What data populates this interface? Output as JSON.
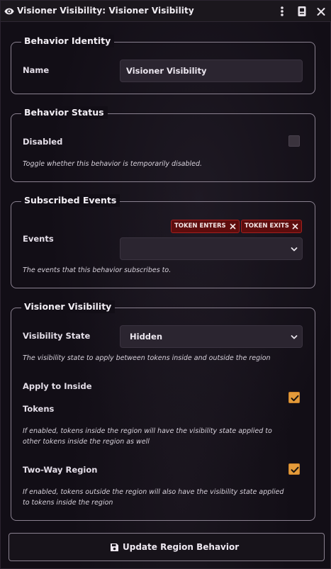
{
  "window": {
    "title": "Visioner Visibility: Visioner Visibility"
  },
  "behavior_identity": {
    "legend": "Behavior Identity",
    "name_label": "Name",
    "name_value": "Visioner Visibility"
  },
  "behavior_status": {
    "legend": "Behavior Status",
    "disabled_label": "Disabled",
    "disabled_checked": false,
    "hint": "Toggle whether this behavior is temporarily disabled."
  },
  "subscribed_events": {
    "legend": "Subscribed Events",
    "events_label": "Events",
    "tags": [
      "TOKEN ENTERS",
      "TOKEN EXITS"
    ],
    "select_value": "",
    "hint": "The events that this behavior subscribes to."
  },
  "visioner_visibility": {
    "legend": "Visioner Visibility",
    "visibility_state_label": "Visibility State",
    "visibility_state_value": "Hidden",
    "visibility_state_hint": "The visibility state to apply between tokens inside and outside the region",
    "apply_inside_label_line1": "Apply to Inside",
    "apply_inside_label_line2": "Tokens",
    "apply_inside_checked": true,
    "apply_inside_hint_line1": "If enabled, tokens inside the region will have the visibility state applied to",
    "apply_inside_hint_line2": "other tokens inside the region as well",
    "two_way_label": "Two-Way Region",
    "two_way_checked": true,
    "two_way_hint_line1": "If enabled, tokens outside the region will also have the visibility state applied",
    "two_way_hint_line2": "to tokens inside the region"
  },
  "footer": {
    "submit_label": "Update Region Behavior",
    "submit_icon": "save-icon"
  },
  "colors": {
    "accent_checkbox": "#e39a3a",
    "tag_background": "#5e0d0d",
    "tag_border": "#a2201e",
    "panel_background": "#120e16"
  }
}
